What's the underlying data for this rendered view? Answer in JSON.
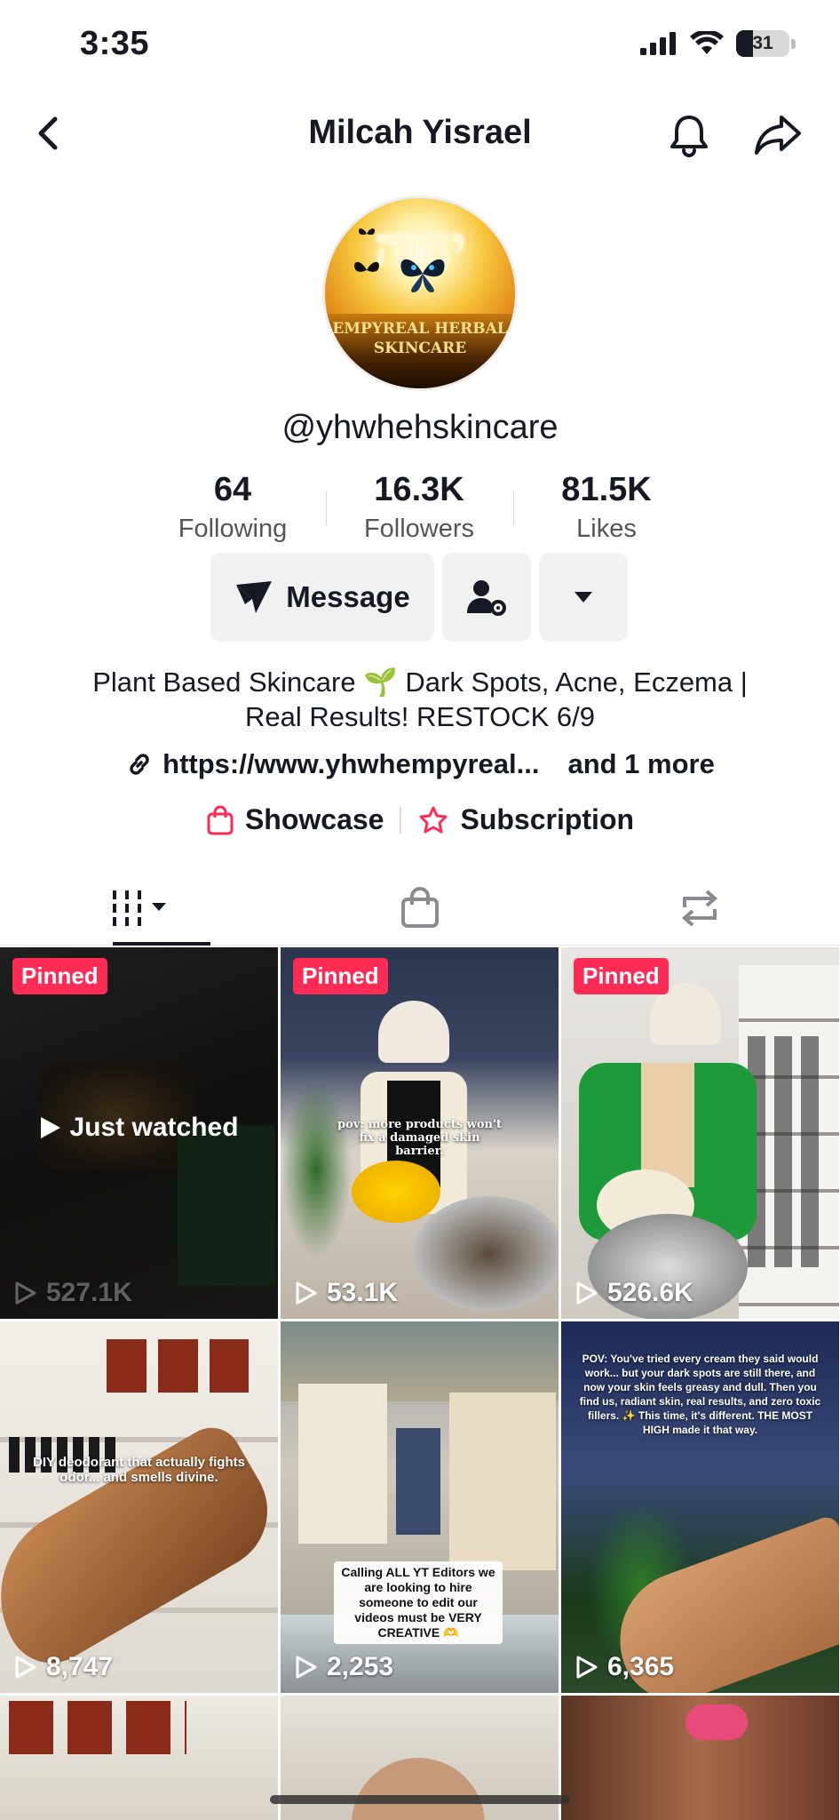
{
  "status_bar": {
    "time": "3:35",
    "battery": "31"
  },
  "nav": {
    "title": "Milcah Yisrael"
  },
  "avatar": {
    "hebrew_text": "יהוה",
    "brand_line1": "EMPYREAL HERBAL",
    "brand_line2": "SKINCARE"
  },
  "profile": {
    "username": "@yhwhehskincare"
  },
  "stats": [
    {
      "value": "64",
      "label": "Following"
    },
    {
      "value": "16.3K",
      "label": "Followers"
    },
    {
      "value": "81.5K",
      "label": "Likes"
    }
  ],
  "actions": {
    "message_label": "Message"
  },
  "bio": {
    "line1": "Plant Based Skincare 🌱 Dark Spots, Acne, Eczema |",
    "line2": "Real Results! RESTOCK 6/9",
    "link": "https://www.yhwhempyreal...",
    "and_more": "and 1 more"
  },
  "extras": {
    "showcase": "Showcase",
    "subscription": "Subscription"
  },
  "colors": {
    "accent": "#fe2c55",
    "text": "#161823",
    "button_bg": "#f1f1f2"
  },
  "grid": {
    "videos": [
      {
        "pinned": "Pinned",
        "views": "527.1K",
        "status": "Just watched",
        "caption": ""
      },
      {
        "pinned": "Pinned",
        "views": "53.1K",
        "caption": "pov: more products won't fix a damaged skin barrier."
      },
      {
        "pinned": "Pinned",
        "views": "526.6K",
        "caption": ""
      },
      {
        "pinned": "",
        "views": "8,747",
        "caption": "DIY deodorant that actually fights odor... and smells divine."
      },
      {
        "pinned": "",
        "views": "2,253",
        "caption": "Calling ALL YT Editors we are looking to hire someone to edit our videos must be VERY CREATIVE 🫶"
      },
      {
        "pinned": "",
        "views": "6,365",
        "caption": "POV: You've tried every cream they said would work... but your dark spots are still there, and now your skin feels greasy and dull. Then you find us, radiant skin, real results, and zero toxic fillers. ✨ This time, it's different. THE MOST HIGH made it that way."
      }
    ]
  }
}
